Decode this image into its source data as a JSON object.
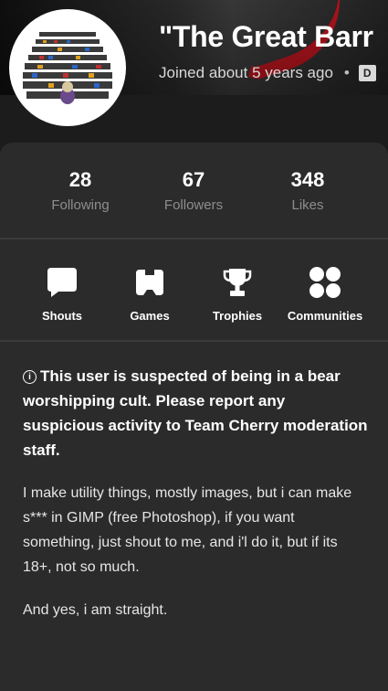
{
  "profile": {
    "title": "\"The Great Barr",
    "joined": "Joined about 5 years ago",
    "badge": "D",
    "accent_color": "#c3121c"
  },
  "stats": [
    {
      "value": "28",
      "label": "Following"
    },
    {
      "value": "67",
      "label": "Followers"
    },
    {
      "value": "348",
      "label": "Likes"
    }
  ],
  "nav": [
    {
      "label": "Shouts",
      "icon": "speech-bubble-icon"
    },
    {
      "label": "Games",
      "icon": "gamepad-icon"
    },
    {
      "label": "Trophies",
      "icon": "trophy-icon"
    },
    {
      "label": "Communities",
      "icon": "communities-icon"
    }
  ],
  "about": {
    "warning": "This user is suspected of being in a bear worshipping cult. Please report any suspicious activity to Team Cherry moderation staff.",
    "bio": [
      "I make utility things, mostly images, but i can make s*** in GIMP (free Photoshop), if you want something, just shout to me, and i'l do it, but if its 18+, not so much.",
      "And yes, i am straight."
    ]
  }
}
